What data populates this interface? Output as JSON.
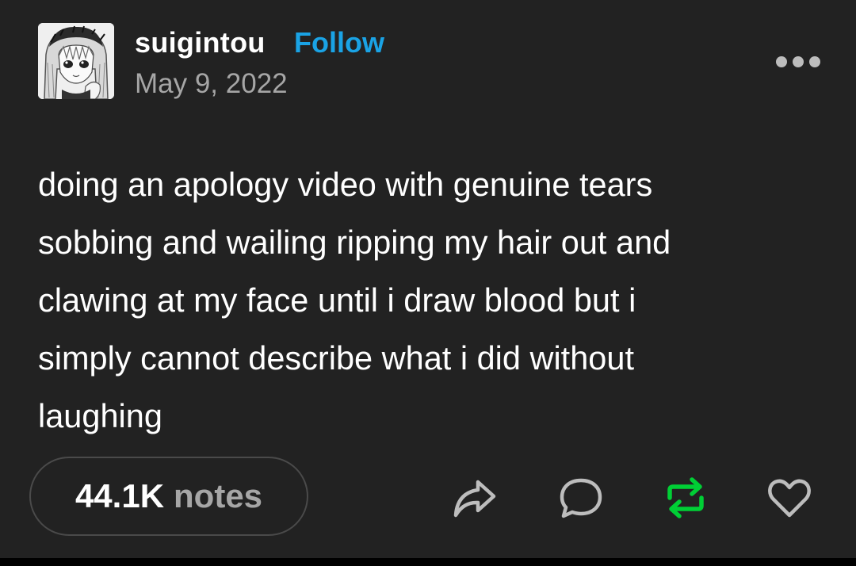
{
  "post": {
    "author": {
      "username": "suigintou",
      "follow_label": "Follow",
      "avatar_icon": "anime-girl-avatar"
    },
    "date": "May 9, 2022",
    "text_lines": [
      "doing an apology video with genuine tears",
      "sobbing and wailing ripping my hair out and",
      "clawing at my face until i draw blood but i",
      "simply cannot describe what i did without",
      "laughing"
    ],
    "notes": {
      "count": "44.1K",
      "label": "notes"
    },
    "actions": [
      {
        "icon": "share-icon"
      },
      {
        "icon": "reply-icon"
      },
      {
        "icon": "reblog-icon",
        "active": true
      },
      {
        "icon": "like-icon"
      }
    ],
    "menu_icon": "more-options-icon"
  },
  "colors": {
    "background": "#222222",
    "text": "#ffffff",
    "muted": "#a6a6a6",
    "follow": "#1aa3e5",
    "reblog_active": "#00cf35",
    "icon": "#bdbdbd"
  }
}
